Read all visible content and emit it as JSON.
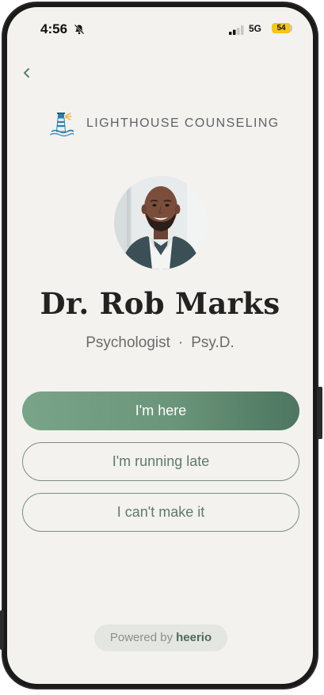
{
  "status_bar": {
    "time": "4:56",
    "network": "5G",
    "battery": "54",
    "bell_icon": "bell-slash-icon",
    "signal_icon": "signal-bars-icon",
    "battery_color": "#f5c518"
  },
  "nav": {
    "back_icon": "chevron-left-icon"
  },
  "brand": {
    "logo_icon": "lighthouse-icon",
    "name": "LIGHTHOUSE COUNSELING"
  },
  "provider": {
    "name": "Dr. Rob Marks",
    "role": "Psychologist",
    "separator": "·",
    "credential": "Psy.D."
  },
  "actions": {
    "here_label": "I'm here",
    "late_label": "I'm running late",
    "cant_label": "I can't make it"
  },
  "footer": {
    "powered_prefix": "Powered by",
    "powered_brand": "heerio"
  },
  "colors": {
    "accent": "#6b957a",
    "background": "#f3f2ef",
    "outline_text": "#5e7a68"
  }
}
